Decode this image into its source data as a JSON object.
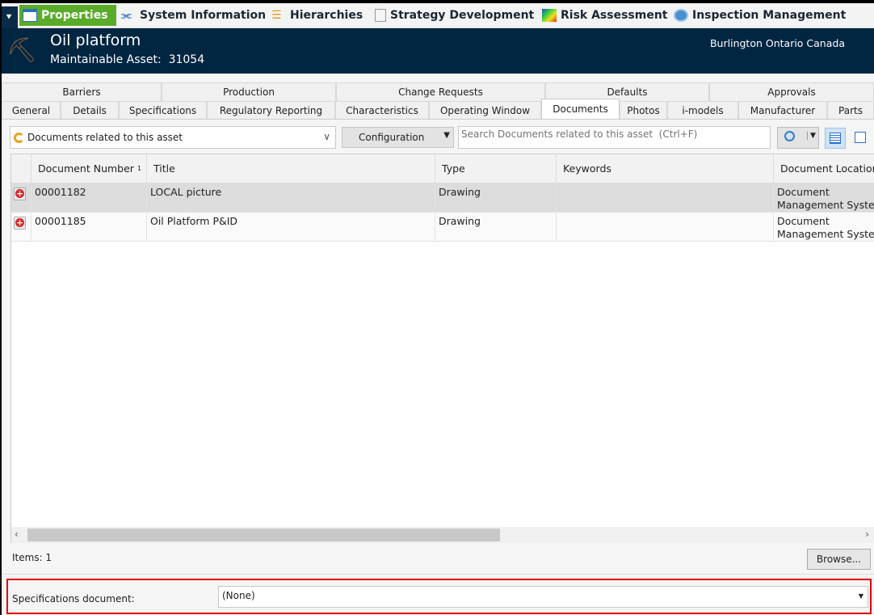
{
  "nav": {
    "items": [
      {
        "label": "Properties",
        "icon": "window-icon",
        "active": true
      },
      {
        "label": "System Information",
        "icon": "tree-connector-icon"
      },
      {
        "label": "Hierarchies",
        "icon": "hierarchy-icon"
      },
      {
        "label": "Strategy Development",
        "icon": "document-icon"
      },
      {
        "label": "Risk Assessment",
        "icon": "risk-matrix-icon"
      },
      {
        "label": "Inspection Management",
        "icon": "gauge-icon"
      }
    ],
    "collapse_icon": "double-chevron-down-icon",
    "active_color": "#5aab2a"
  },
  "header": {
    "title": "Oil platform",
    "subtitle_label": "Maintainable Asset:",
    "subtitle_value": "31054",
    "location": "Burlington Ontario Canada",
    "bg_color": "#002642"
  },
  "tabs_row1": [
    "Barriers",
    "Production",
    "Change Requests",
    "Defaults",
    "Approvals"
  ],
  "tabs_row2": [
    "General",
    "Details",
    "Specifications",
    "Regulatory Reporting",
    "Characteristics",
    "Operating Window",
    "Documents",
    "Photos",
    "i-models",
    "Manufacturer",
    "Parts"
  ],
  "selected_tab": "Documents",
  "toolbar": {
    "query_value": "Documents related to this asset",
    "configuration_label": "Configuration",
    "search_placeholder": "Search Documents related to this asset  (Ctrl+F)"
  },
  "grid": {
    "columns": [
      "Document Number",
      "Title",
      "Type",
      "Keywords",
      "Document Location"
    ],
    "sort_indicator": "1",
    "rows": [
      {
        "number": "00001182",
        "title": "LOCAL picture",
        "type": "Drawing",
        "keywords": "",
        "location1": "Document",
        "location2": "Management System"
      },
      {
        "number": "00001185",
        "title": "Oil Platform P&ID",
        "type": "Drawing",
        "keywords": "",
        "location1": "Document",
        "location2": "Management System"
      }
    ]
  },
  "footer": {
    "items_label": "Items: 1",
    "browse_label": "Browse..."
  },
  "spec": {
    "label": "Specifications document:",
    "value": "(None)",
    "highlight_color": "#e00000"
  }
}
